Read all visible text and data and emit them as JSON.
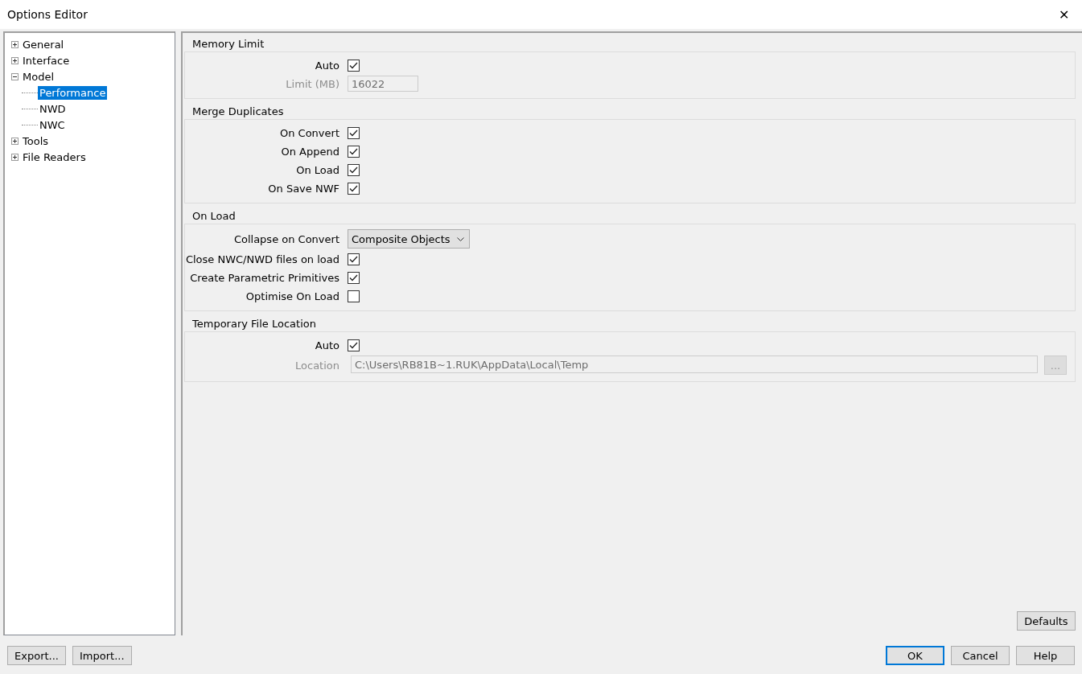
{
  "window": {
    "title": "Options Editor",
    "close": "✕"
  },
  "tree": [
    {
      "label": "General",
      "expanded": false,
      "selected": false
    },
    {
      "label": "Interface",
      "expanded": false,
      "selected": false
    },
    {
      "label": "Model",
      "expanded": true,
      "selected": false,
      "children": [
        {
          "label": "Performance",
          "selected": true
        },
        {
          "label": "NWD",
          "selected": false
        },
        {
          "label": "NWC",
          "selected": false
        }
      ]
    },
    {
      "label": "Tools",
      "expanded": false,
      "selected": false
    },
    {
      "label": "File Readers",
      "expanded": false,
      "selected": false
    }
  ],
  "sections": [
    {
      "title": "Memory Limit",
      "rows": [
        {
          "kind": "checkbox",
          "label": "Auto",
          "checked": true
        },
        {
          "kind": "field",
          "label": "Limit (MB)",
          "value": "16022",
          "disabled": true
        }
      ]
    },
    {
      "title": "Merge Duplicates",
      "rows": [
        {
          "kind": "checkbox",
          "label": "On Convert",
          "checked": true
        },
        {
          "kind": "checkbox",
          "label": "On Append",
          "checked": true
        },
        {
          "kind": "checkbox",
          "label": "On Load",
          "checked": true
        },
        {
          "kind": "checkbox",
          "label": "On Save NWF",
          "checked": true
        }
      ]
    },
    {
      "title": "On Load",
      "rows": [
        {
          "kind": "dropdown",
          "label": "Collapse on Convert",
          "value": "Composite Objects"
        },
        {
          "kind": "checkbox",
          "label": "Close NWC/NWD files on load",
          "checked": true
        },
        {
          "kind": "checkbox",
          "label": "Create Parametric Primitives",
          "checked": true
        },
        {
          "kind": "checkbox",
          "label": "Optimise On Load",
          "checked": false
        }
      ]
    },
    {
      "title": "Temporary File Location",
      "rows": [
        {
          "kind": "checkbox",
          "label": "Auto",
          "checked": true
        },
        {
          "kind": "path",
          "label": "Location",
          "value": "C:\\Users\\RB81B~1.RUK\\AppData\\Local\\Temp",
          "disabled": true,
          "browse": "..."
        }
      ]
    }
  ],
  "defaults_button": "Defaults",
  "footer_left": [
    "Export...",
    "Import..."
  ],
  "footer_right": [
    {
      "label": "OK",
      "default": true
    },
    {
      "label": "Cancel",
      "default": false
    },
    {
      "label": "Help",
      "default": false
    }
  ]
}
